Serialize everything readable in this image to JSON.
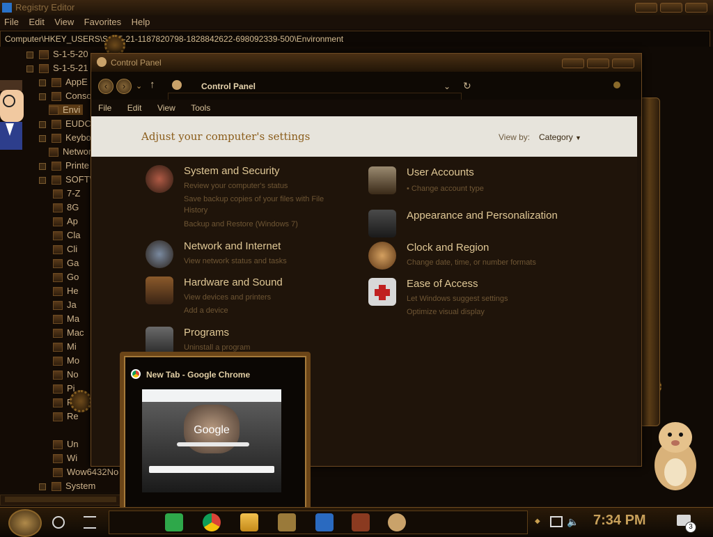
{
  "registry": {
    "title": "Registry Editor",
    "menu": [
      "File",
      "Edit",
      "View",
      "Favorites",
      "Help"
    ],
    "address": "Computer\\HKEY_USERS\\S-1-5-21-1187820798-1828842622-698092339-500\\Environment",
    "tree": [
      "S-1-5-20",
      "S-1-5-21",
      "AppE",
      "Conso",
      "Envi",
      "EUDC",
      "Keyboard Layout",
      "Networ",
      "Printe",
      "SOFTWARE",
      "7-Z",
      "8G",
      "Ap",
      "Cla",
      "Cli",
      "Ga",
      "Go",
      "He",
      "Ja",
      "Ma",
      "Mac",
      "Mi",
      "Mo",
      "No",
      "Pi",
      "Po",
      "Re",
      "Un",
      "Wi",
      "Wow6432No",
      "System"
    ]
  },
  "control_panel": {
    "title": "Control Panel",
    "path": "Control Panel",
    "menu": [
      "File",
      "Edit",
      "View",
      "Tools"
    ],
    "heading": "Adjust your computer's settings",
    "view_by_label": "View by:",
    "view_by_value": "Category",
    "categories_left": [
      {
        "title": "System and Security",
        "links": [
          "Review your computer's status",
          "Save backup copies of your files with File",
          "History",
          "Backup and Restore (Windows 7)"
        ]
      },
      {
        "title": "Network and Internet",
        "links": [
          "View network status and tasks"
        ]
      },
      {
        "title": "Hardware and Sound",
        "links": [
          "View devices and printers",
          "Add a device"
        ]
      },
      {
        "title": "Programs",
        "links": [
          "Uninstall a program"
        ]
      }
    ],
    "categories_right": [
      {
        "title": "User Accounts",
        "links": [
          "Change account type"
        ]
      },
      {
        "title": "Appearance and Personalization",
        "links": []
      },
      {
        "title": "Clock and Region",
        "links": [
          "Change date, time, or number formats"
        ]
      },
      {
        "title": "Ease of Access",
        "links": [
          "Let Windows suggest settings",
          "Optimize visual display"
        ]
      }
    ]
  },
  "chrome_thumb": {
    "title": "New Tab - Google Chrome",
    "logo_text": "Google"
  },
  "taskbar": {
    "clock": "7:34 PM",
    "notification_count": "3"
  },
  "icons": [
    "windows-logo-icon",
    "gear-start-icon",
    "search-icon",
    "task-view-icon",
    "chrome-icon",
    "folder-icon",
    "speaker-mute-icon",
    "network-icon",
    "notification-icon"
  ]
}
